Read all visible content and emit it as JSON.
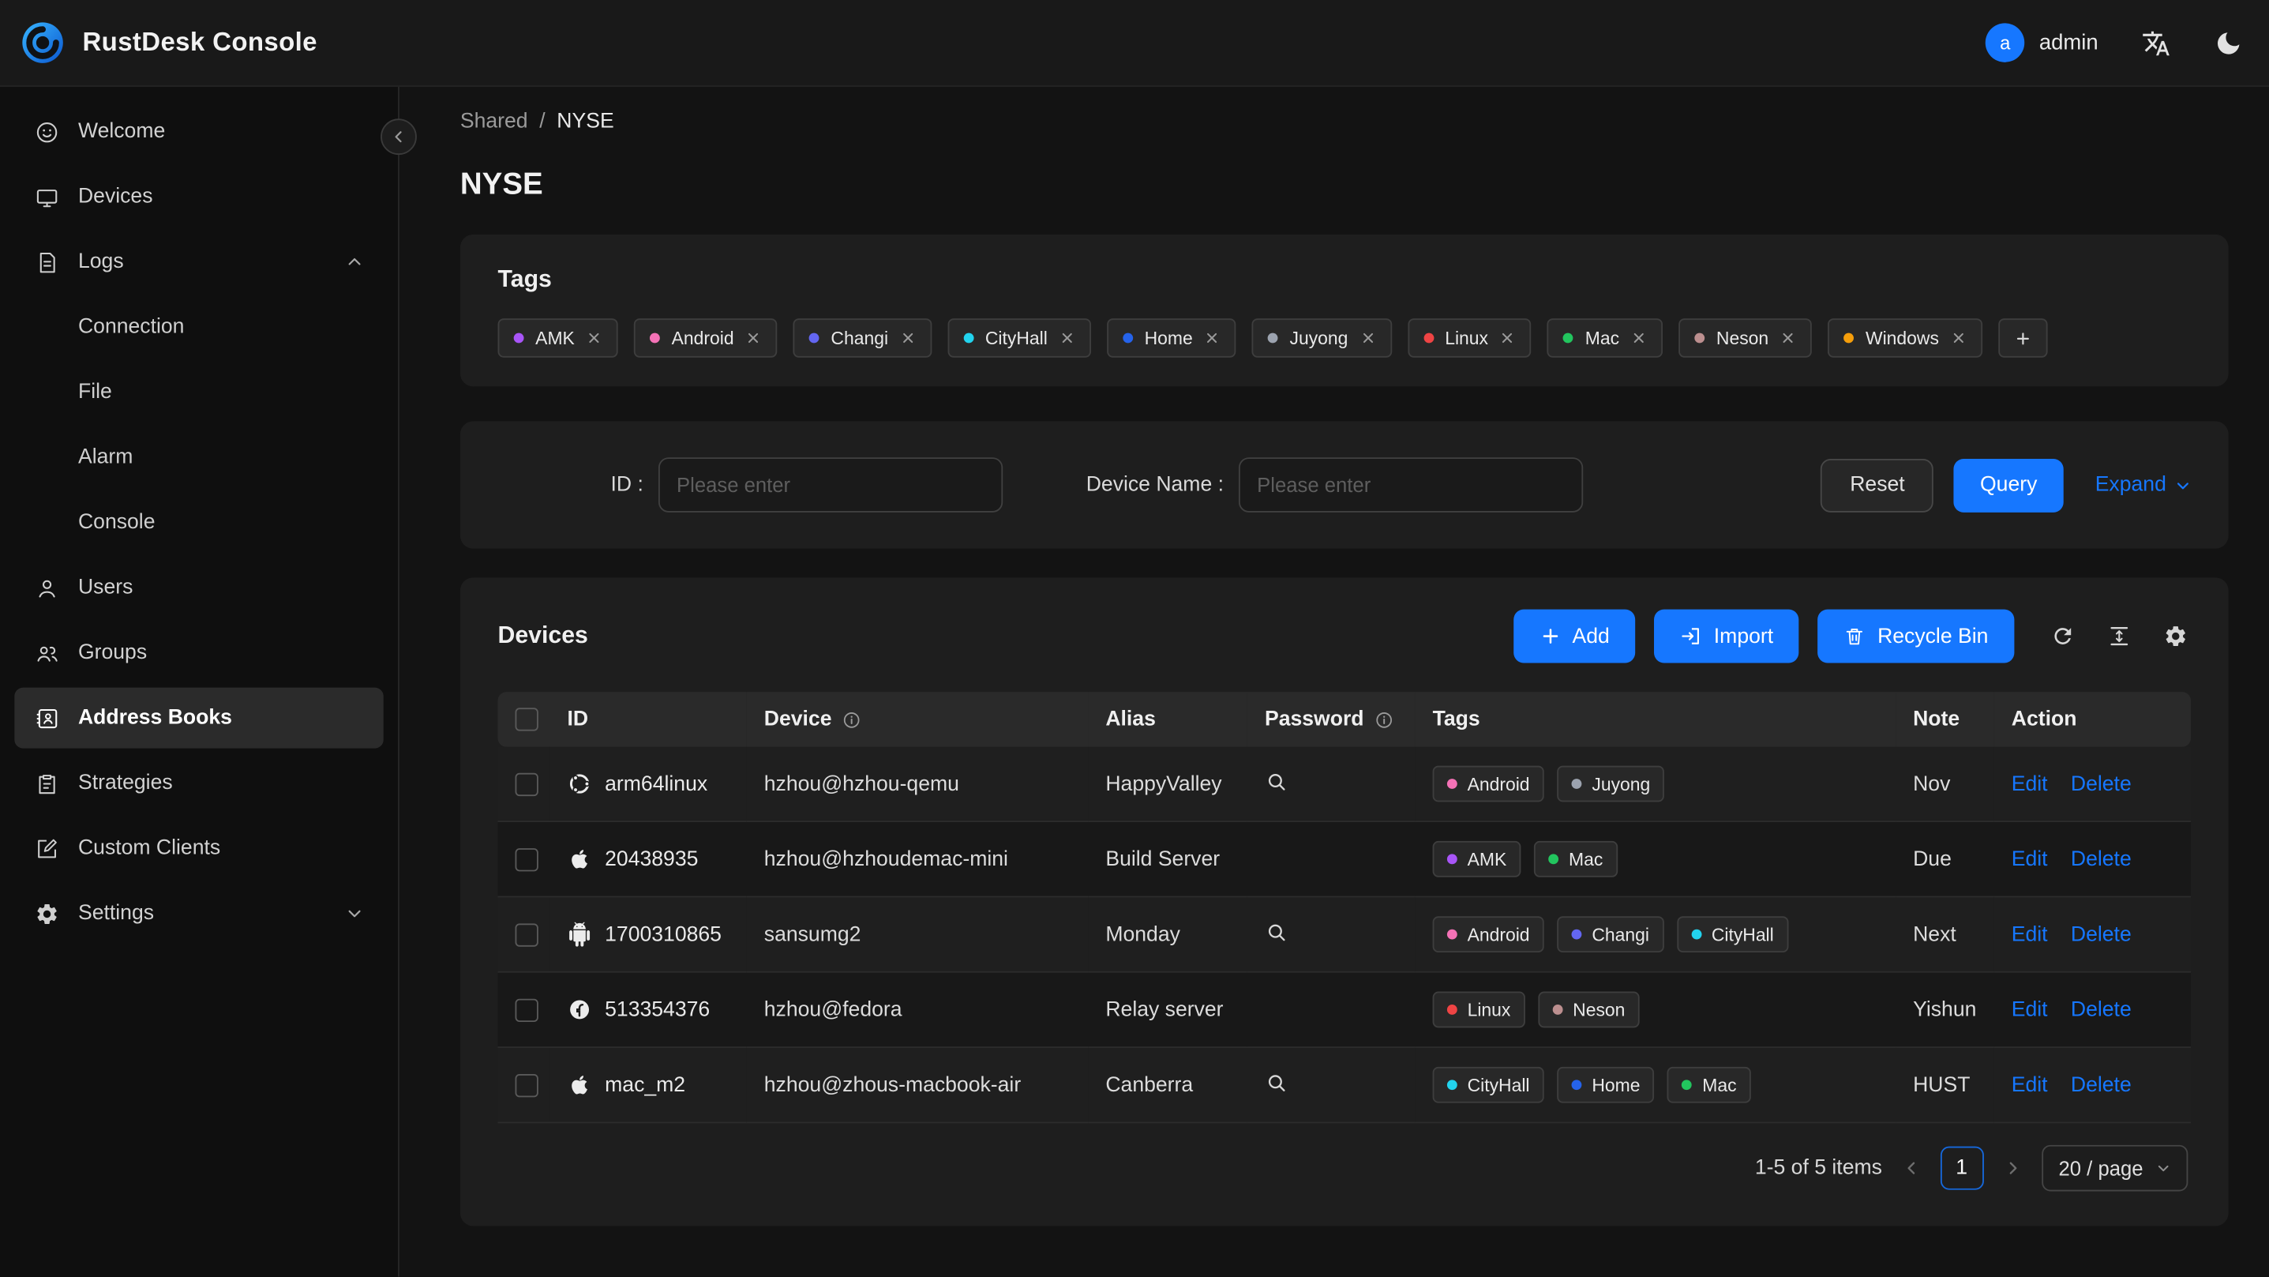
{
  "header": {
    "app_title": "RustDesk Console",
    "user_initial": "a",
    "user_name": "admin"
  },
  "sidebar": {
    "items": [
      {
        "label": "Welcome"
      },
      {
        "label": "Devices"
      },
      {
        "label": "Logs",
        "children": [
          {
            "label": "Connection"
          },
          {
            "label": "File"
          },
          {
            "label": "Alarm"
          },
          {
            "label": "Console"
          }
        ]
      },
      {
        "label": "Users"
      },
      {
        "label": "Groups"
      },
      {
        "label": "Address Books"
      },
      {
        "label": "Strategies"
      },
      {
        "label": "Custom Clients"
      },
      {
        "label": "Settings"
      }
    ]
  },
  "breadcrumb": {
    "parent": "Shared",
    "separator": "/",
    "current": "NYSE"
  },
  "page": {
    "title": "NYSE"
  },
  "tags_card": {
    "title": "Tags",
    "tags": [
      {
        "label": "AMK",
        "color": "#a855f7"
      },
      {
        "label": "Android",
        "color": "#f472b6"
      },
      {
        "label": "Changi",
        "color": "#6366f1"
      },
      {
        "label": "CityHall",
        "color": "#22d3ee"
      },
      {
        "label": "Home",
        "color": "#2563eb"
      },
      {
        "label": "Juyong",
        "color": "#9ca3af"
      },
      {
        "label": "Linux",
        "color": "#ef4444"
      },
      {
        "label": "Mac",
        "color": "#22c55e"
      },
      {
        "label": "Neson",
        "color": "#bc8f8f"
      },
      {
        "label": "Windows",
        "color": "#f59e0b"
      }
    ]
  },
  "filter": {
    "id_label": "ID :",
    "id_placeholder": "Please enter",
    "device_label": "Device Name :",
    "device_placeholder": "Please enter",
    "reset_label": "Reset",
    "query_label": "Query",
    "expand_label": "Expand"
  },
  "devices_card": {
    "title": "Devices",
    "add_label": "Add",
    "import_label": "Import",
    "recycle_bin_label": "Recycle Bin",
    "table": {
      "columns": [
        {
          "key": "id",
          "label": "ID"
        },
        {
          "key": "device",
          "label": "Device",
          "info": true
        },
        {
          "key": "alias",
          "label": "Alias"
        },
        {
          "key": "password",
          "label": "Password",
          "info": true
        },
        {
          "key": "tags",
          "label": "Tags"
        },
        {
          "key": "note",
          "label": "Note"
        },
        {
          "key": "action",
          "label": "Action"
        }
      ],
      "edit_label": "Edit",
      "delete_label": "Delete",
      "rows": [
        {
          "os": "ubuntu",
          "id": "arm64linux",
          "device": "hzhou@hzhou-qemu",
          "alias": "HappyValley",
          "password_viewable": true,
          "tags": [
            "Android",
            "Juyong"
          ],
          "note": "Nov"
        },
        {
          "os": "apple",
          "id": "20438935",
          "device": "hzhou@hzhoudemac-mini",
          "alias": "Build Server",
          "password_viewable": false,
          "tags": [
            "AMK",
            "Mac"
          ],
          "note": "Due"
        },
        {
          "os": "android",
          "id": "1700310865",
          "device": "sansumg2",
          "alias": "Monday",
          "password_viewable": true,
          "tags": [
            "Android",
            "Changi",
            "CityHall"
          ],
          "note": "Next"
        },
        {
          "os": "fedora",
          "id": "513354376",
          "device": "hzhou@fedora",
          "alias": "Relay server",
          "password_viewable": false,
          "tags": [
            "Linux",
            "Neson"
          ],
          "note": "Yishun"
        },
        {
          "os": "apple",
          "id": "mac_m2",
          "device": "hzhou@zhous-macbook-air",
          "alias": "Canberra",
          "password_viewable": true,
          "tags": [
            "CityHall",
            "Home",
            "Mac"
          ],
          "note": "HUST"
        }
      ]
    },
    "pagination": {
      "total": "1-5 of 5 items",
      "page": "1",
      "page_size": "20 / page"
    }
  }
}
